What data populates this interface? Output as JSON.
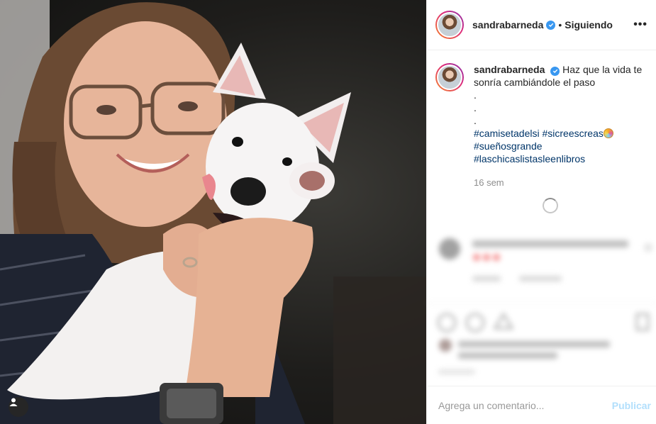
{
  "post": {
    "username": "sandrabarneda",
    "following_label": "Siguiendo",
    "more_label": "•••",
    "caption_lines": [
      "Haz que la vida te",
      "sonría cambiándole el paso"
    ],
    "dots": [
      ".",
      ".",
      "."
    ],
    "hashtags_line1": [
      "#camisetadelsi",
      "#sicreescreas"
    ],
    "hashtags_line2": [
      "#sueñosgrande"
    ],
    "hashtags_line3": [
      "#laschicaslistasleenlibros"
    ],
    "time_ago": "16 sem"
  },
  "comment": {
    "placeholder": "Agrega un comentario...",
    "publish_label": "Publicar"
  },
  "colors": {
    "accent": "#3897f0",
    "hashtag": "#003569",
    "publish_disabled": "#b2dffc"
  },
  "icons": [
    "verified-badge-icon",
    "more-options-icon",
    "user-tag-icon",
    "loading-spinner-icon",
    "lollipop-emoji-icon"
  ]
}
